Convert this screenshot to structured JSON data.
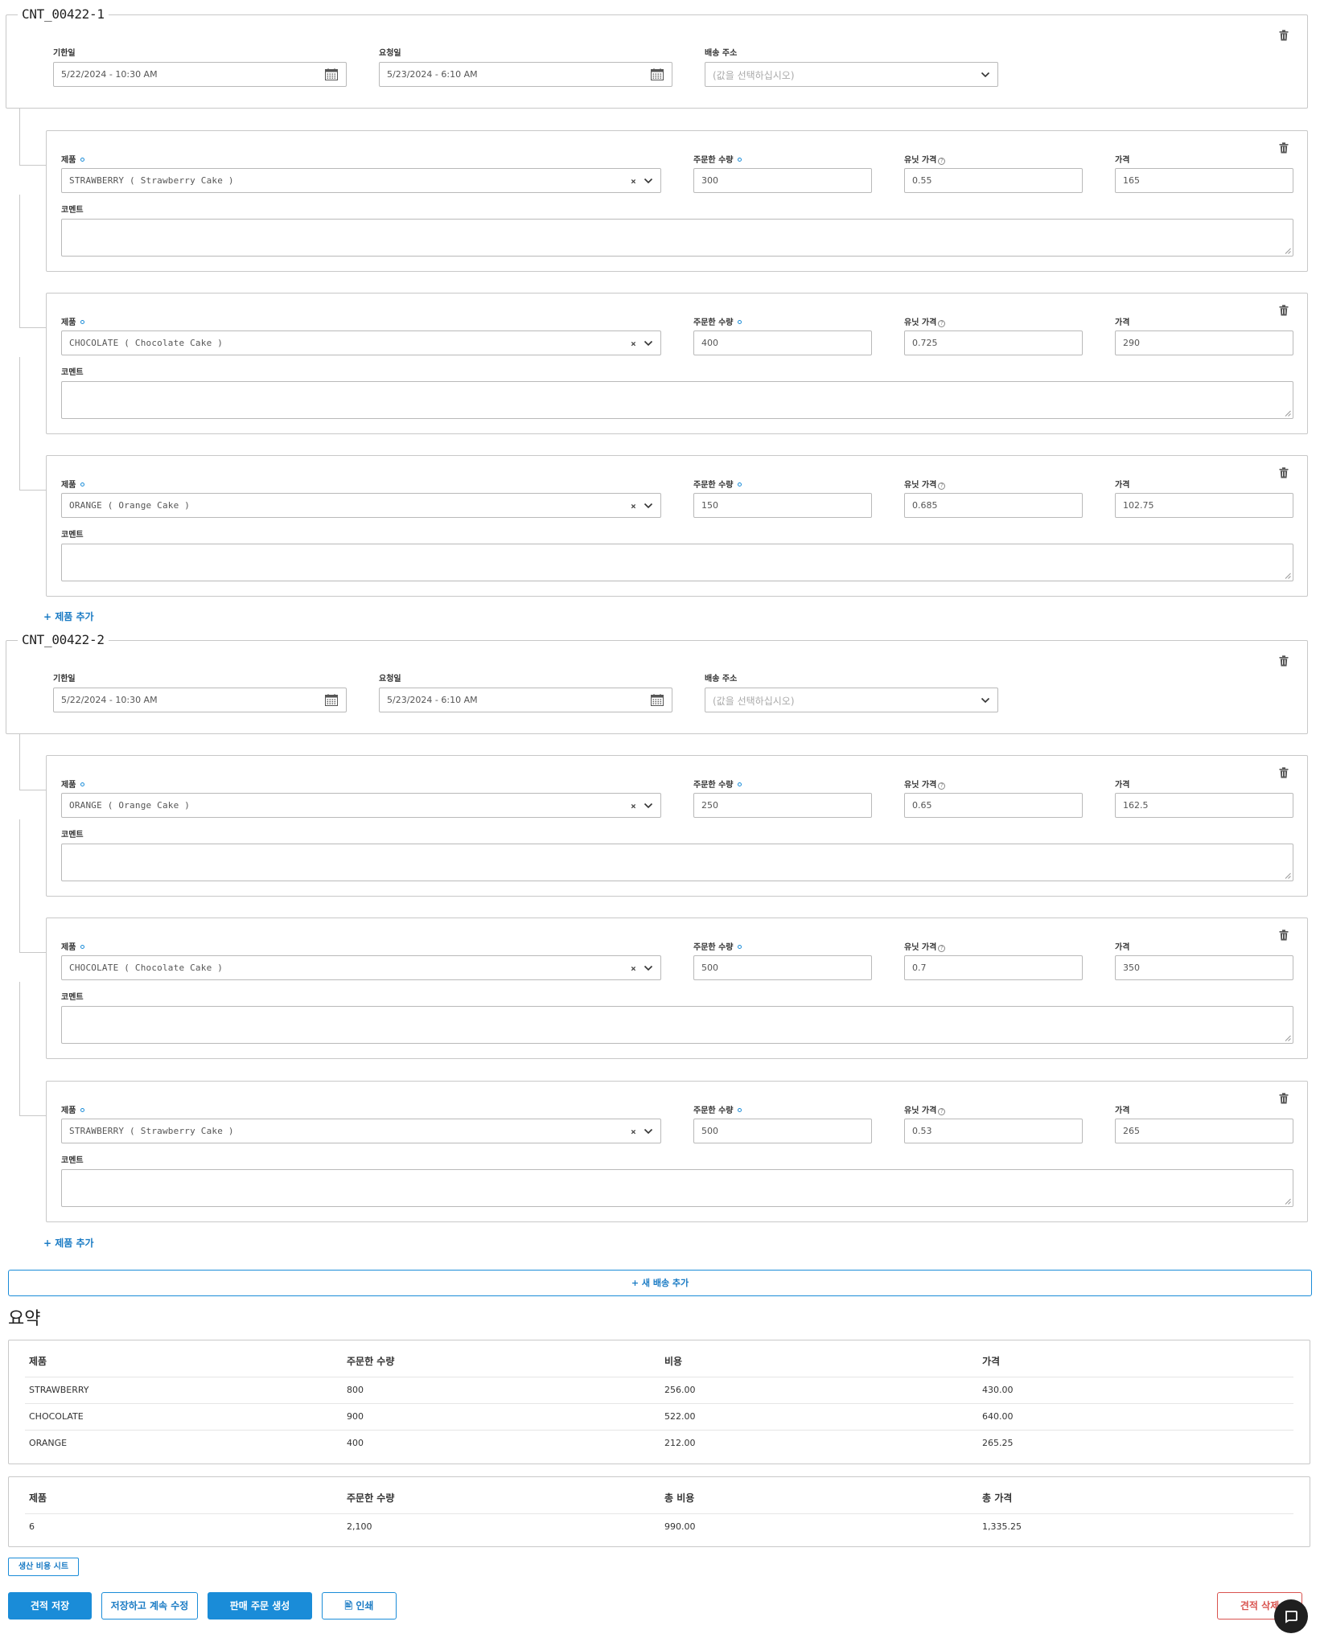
{
  "labels": {
    "due_date": "기한일",
    "request_date": "요청일",
    "shipping_address": "배송 주소",
    "product": "제품",
    "quantity": "주문한 수량",
    "unit_price": "유닛 가격",
    "price": "가격",
    "comment": "코멘트"
  },
  "shipments": [
    {
      "id": "CNT_00422-1",
      "due_date": "5/22/2024 - 10:30 AM",
      "request_date": "5/23/2024 - 6:10 AM",
      "address_placeholder": "(값을 선택하십시오)",
      "items": [
        {
          "product": "STRAWBERRY ( Strawberry Cake )",
          "quantity": "300",
          "unit_price": "0.55",
          "price": "165",
          "comment": ""
        },
        {
          "product": "CHOCOLATE ( Chocolate Cake )",
          "quantity": "400",
          "unit_price": "0.725",
          "price": "290",
          "comment": ""
        },
        {
          "product": "ORANGE ( Orange Cake )",
          "quantity": "150",
          "unit_price": "0.685",
          "price": "102.75",
          "comment": ""
        }
      ],
      "add_product": "제품 추가"
    },
    {
      "id": "CNT_00422-2",
      "due_date": "5/22/2024 - 10:30 AM",
      "request_date": "5/23/2024 - 6:10 AM",
      "address_placeholder": "(값을 선택하십시오)",
      "items": [
        {
          "product": "ORANGE ( Orange Cake )",
          "quantity": "250",
          "unit_price": "0.65",
          "price": "162.5",
          "comment": ""
        },
        {
          "product": "CHOCOLATE ( Chocolate Cake )",
          "quantity": "500",
          "unit_price": "0.7",
          "price": "350",
          "comment": ""
        },
        {
          "product": "STRAWBERRY ( Strawberry Cake )",
          "quantity": "500",
          "unit_price": "0.53",
          "price": "265",
          "comment": ""
        }
      ],
      "add_product": "제품 추가"
    }
  ],
  "add_shipment": "새 배송 추가",
  "summary": {
    "title": "요약",
    "headers": [
      "제품",
      "주문한 수량",
      "비용",
      "가격"
    ],
    "rows": [
      [
        "STRAWBERRY",
        "800",
        "256.00",
        "430.00"
      ],
      [
        "CHOCOLATE",
        "900",
        "522.00",
        "640.00"
      ],
      [
        "ORANGE",
        "400",
        "212.00",
        "265.25"
      ]
    ],
    "total_headers": [
      "제품",
      "주문한 수량",
      "총 비용",
      "총 가격"
    ],
    "total_row": [
      "6",
      "2,100",
      "990.00",
      "1,335.25"
    ]
  },
  "buttons": {
    "cost_sheet": "생산 비용 시트",
    "save_quote": "견적 저장",
    "save_continue": "저장하고 계속 수정",
    "create_sales_order": "판매 주문 생성",
    "print": "인쇄",
    "delete_quote": "견적 삭제"
  },
  "colors": {
    "accent": "#1a8cd8",
    "danger": "#d9534f",
    "border": "#c8c8c8"
  },
  "icons": [
    "trash-icon",
    "calendar-icon",
    "chevron-down-icon",
    "clear-icon",
    "plus-icon",
    "print-icon",
    "chat-icon",
    "help-icon"
  ]
}
